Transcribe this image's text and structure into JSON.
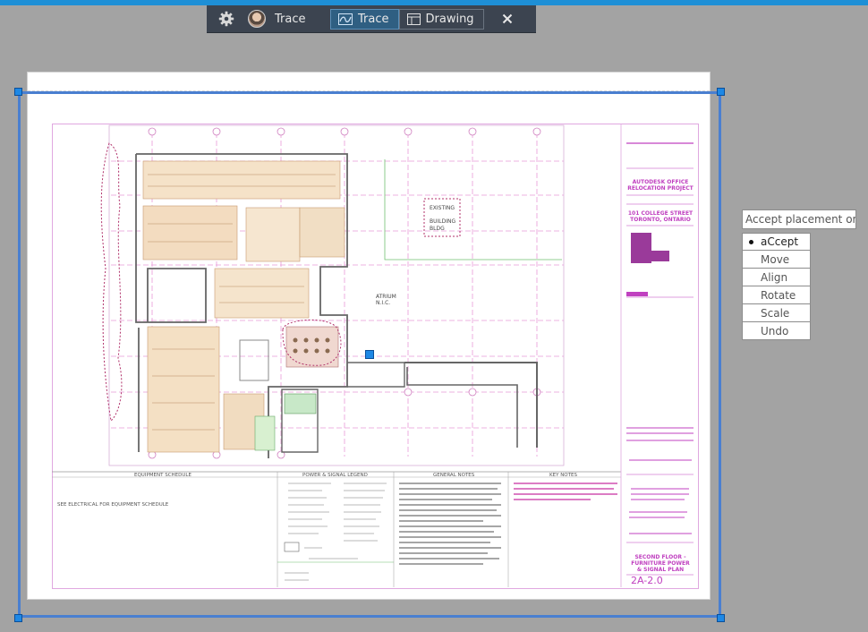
{
  "toolbar": {
    "trace_label": "Trace",
    "tabs": [
      {
        "label": "Trace",
        "active": true
      },
      {
        "label": "Drawing",
        "active": false
      }
    ],
    "icons": [
      "gear-icon",
      "avatar",
      "trace-icon",
      "drawing-icon",
      "close-icon"
    ]
  },
  "prompt": {
    "text": "Accept placement or"
  },
  "menu": {
    "options": [
      {
        "label": "aCcept",
        "selected": true
      },
      {
        "label": "Move",
        "selected": false
      },
      {
        "label": "Align",
        "selected": false
      },
      {
        "label": "Rotate",
        "selected": false
      },
      {
        "label": "Scale",
        "selected": false
      },
      {
        "label": "Undo",
        "selected": false
      }
    ]
  },
  "drawing": {
    "existing_building": [
      "EXISTING",
      "BUILDING",
      "BLDG"
    ],
    "atrium": [
      "ATRIUM",
      "N.I.C."
    ],
    "equipment_schedule_title": "EQUIPMENT SCHEDULE",
    "equipment_schedule_note": "SEE ELECTRICAL FOR EQUIPMENT SCHEDULE",
    "power_signal_legend_title": "POWER & SIGNAL LEGEND",
    "general_notes_title": "GENERAL NOTES",
    "key_notes_title": "KEY NOTES",
    "titleblock": {
      "project_lines": [
        "AUTODESK OFFICE",
        "RELOCATION PROJECT"
      ],
      "address_lines": [
        "101 COLLEGE STREET",
        "TORONTO, ONTARIO"
      ],
      "sheet_title_lines": [
        "SECOND FLOOR -",
        "FURNITURE POWER",
        "& SIGNAL PLAN"
      ],
      "sheet_number": "2A-2.0"
    }
  },
  "colors": {
    "accent": "#1e8fd6",
    "toolbar_bg": "#3c4450",
    "active_tab": "#2f5f82",
    "placement_frame": "#4a7fd0",
    "markup_magenta": "#c040c0"
  }
}
